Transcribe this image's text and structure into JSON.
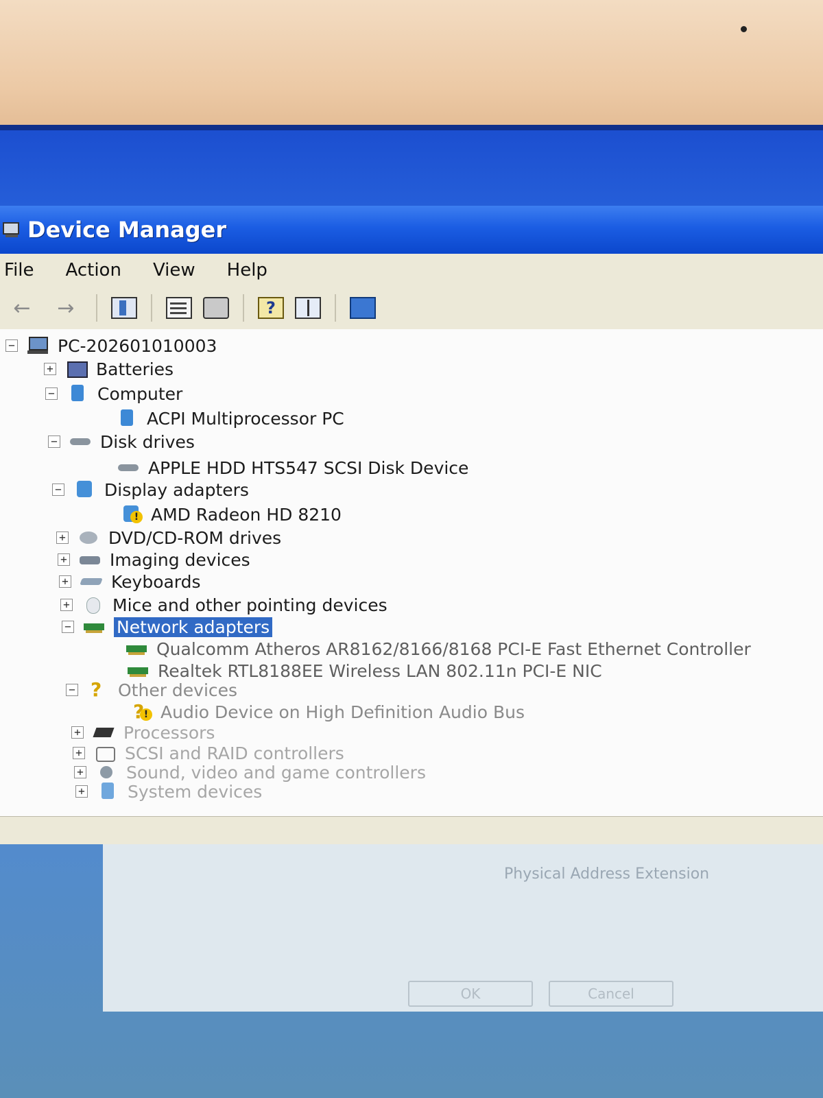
{
  "window": {
    "title": "Device Manager"
  },
  "menu": [
    "File",
    "Action",
    "View",
    "Help"
  ],
  "toolbar": {
    "icons": [
      "back-icon",
      "forward-icon",
      "show-hide-console-tree-icon",
      "properties-icon",
      "print-icon",
      "help-icon",
      "show-hide-action-pane-icon",
      "scan-hardware-icon"
    ]
  },
  "tree": {
    "root": "PC-202601010003",
    "categories": [
      {
        "label": "Batteries",
        "expanded": false
      },
      {
        "label": "Computer",
        "expanded": true,
        "children": [
          "ACPI Multiprocessor PC"
        ]
      },
      {
        "label": "Disk drives",
        "expanded": true,
        "children": [
          "APPLE HDD HTS547 SCSI Disk Device"
        ]
      },
      {
        "label": "Display adapters",
        "expanded": true,
        "children": [
          "AMD Radeon HD 8210"
        ]
      },
      {
        "label": "DVD/CD-ROM drives",
        "expanded": false
      },
      {
        "label": "Imaging devices",
        "expanded": false
      },
      {
        "label": "Keyboards",
        "expanded": false
      },
      {
        "label": "Mice and other pointing devices",
        "expanded": false
      },
      {
        "label": "Network adapters",
        "expanded": true,
        "selected": true,
        "children": [
          "Qualcomm Atheros AR8162/8166/8168 PCI-E Fast Ethernet Controller",
          "Realtek RTL8188EE Wireless LAN 802.11n PCI-E NIC"
        ]
      },
      {
        "label": "Other devices",
        "expanded": true,
        "children": [
          "Audio Device on High Definition Audio Bus"
        ]
      },
      {
        "label": "Processors",
        "expanded": false
      },
      {
        "label": "SCSI and RAID controllers",
        "expanded": false
      },
      {
        "label": "Sound, video and game controllers",
        "expanded": false
      },
      {
        "label": "System devices",
        "expanded": false
      }
    ]
  },
  "background_dialog": {
    "text": "Physical Address Extension",
    "ok_label": "OK",
    "cancel_label": "Cancel"
  },
  "colors": {
    "titlebar": "#0b47cc",
    "selection": "#316ac5",
    "menubar": "#ece9d8"
  }
}
